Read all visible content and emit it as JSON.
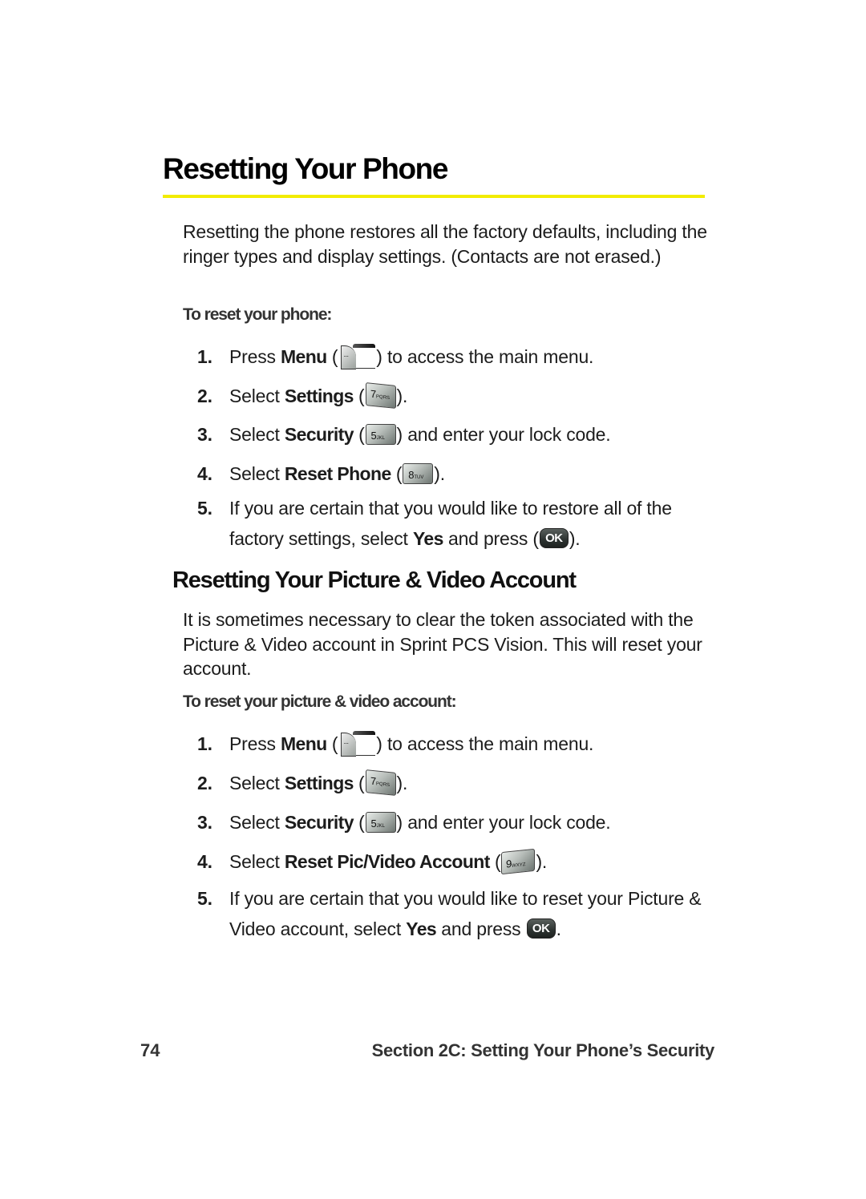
{
  "section1": {
    "title": "Resetting Your Phone",
    "intro": "Resetting the phone restores all the factory defaults, including the ringer types and display settings. (Contacts are not erased.)",
    "subheading": "To reset your phone:",
    "steps": [
      {
        "num": "1.",
        "pre": "Press ",
        "bold": "Menu",
        "mid": " (",
        "key": "menu-key",
        "post": ") to access the main menu."
      },
      {
        "num": "2.",
        "pre": "Select ",
        "bold": "Settings",
        "mid": " (",
        "key": "7PQRS",
        "post": ")."
      },
      {
        "num": "3.",
        "pre": "Select ",
        "bold": "Security",
        "mid": " (",
        "key": "5JKL",
        "post": ") and enter your lock code."
      },
      {
        "num": "4.",
        "pre": "Select ",
        "bold": "Reset Phone",
        "mid": " (",
        "key": "8TUV",
        "post": ")."
      },
      {
        "num": "5.",
        "pre": "If you are certain that you would like to restore all of the factory settings, select ",
        "bold": "Yes",
        "mid": " and press (",
        "key": "OK",
        "post": ")."
      }
    ]
  },
  "section2": {
    "title": "Resetting Your Picture & Video Account",
    "intro": "It is sometimes necessary to clear the token associated with the Picture & Video account in Sprint PCS Vision. This will reset your account.",
    "subheading": "To reset your picture & video account:",
    "steps": [
      {
        "num": "1.",
        "pre": "Press ",
        "bold": "Menu",
        "mid": " (",
        "key": "menu-key",
        "post": ") to access the main menu."
      },
      {
        "num": "2.",
        "pre": "Select ",
        "bold": "Settings",
        "mid": " (",
        "key": "7PQRS",
        "post": ")."
      },
      {
        "num": "3.",
        "pre": "Select ",
        "bold": "Security",
        "mid": " (",
        "key": "5JKL",
        "post": ") and enter your lock code."
      },
      {
        "num": "4.",
        "pre": "Select ",
        "bold": "Reset Pic/Video Account",
        "mid": " (",
        "key": "9WXYZ",
        "post": ")."
      },
      {
        "num": "5.",
        "pre": "If you are certain that you would like to reset your Picture & Video account, select ",
        "bold": "Yes",
        "mid": " and press ",
        "key": "OK",
        "post": "."
      }
    ]
  },
  "keys": {
    "k7": {
      "digit": "7",
      "letters": "PQRS"
    },
    "k5": {
      "digit": "5",
      "letters": "JKL"
    },
    "k8": {
      "digit": "8",
      "letters": "TUV"
    },
    "k9": {
      "digit": "9",
      "letters": "WXYZ"
    },
    "ok": "OK",
    "menu_dots": "···"
  },
  "footer": {
    "page_number": "74",
    "section": "Section 2C: Setting Your Phone’s Security"
  },
  "colors": {
    "rule": "#f2ec00"
  }
}
